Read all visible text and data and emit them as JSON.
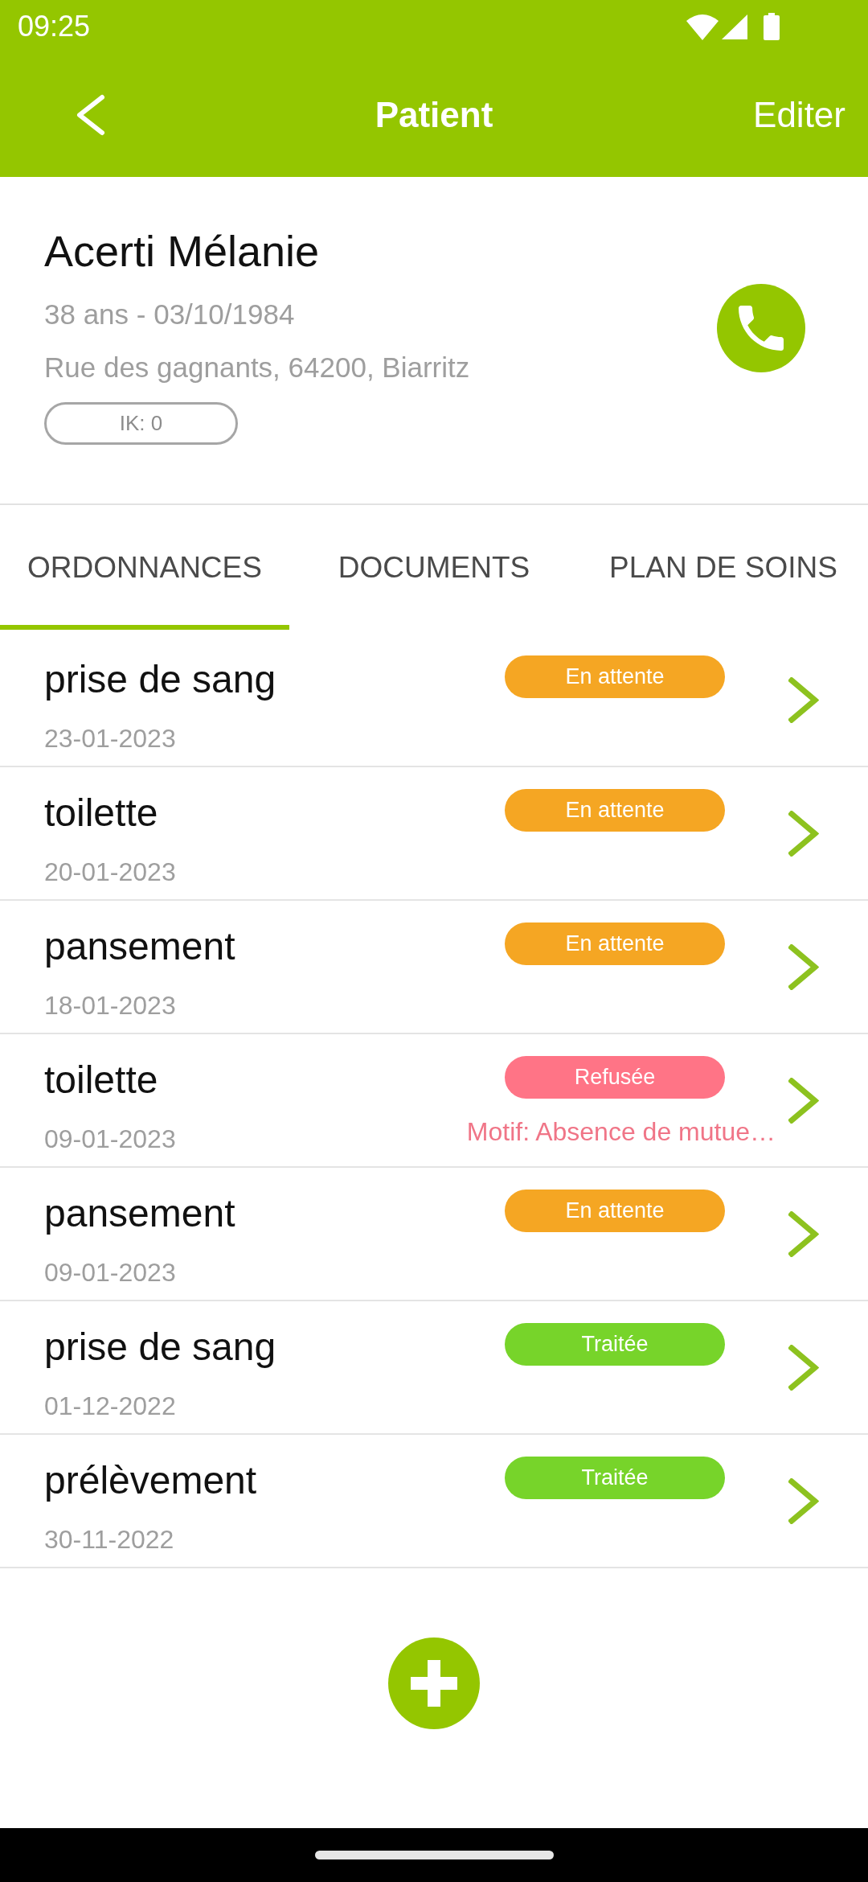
{
  "status_bar": {
    "time": "09:25"
  },
  "toolbar": {
    "title": "Patient",
    "action": "Editer"
  },
  "patient": {
    "name": "Acerti Mélanie",
    "age_birthdate": "38 ans - 03/10/1984",
    "address": "Rue des gagnants, 64200, Biarritz",
    "ik": "IK: 0"
  },
  "tabs": [
    {
      "label": "ORDONNANCES",
      "selected": true
    },
    {
      "label": "DOCUMENTS",
      "selected": false
    },
    {
      "label": "PLAN DE SOINS",
      "selected": false
    }
  ],
  "prescriptions": [
    {
      "title": "prise de sang",
      "date": "23-01-2023",
      "status": {
        "label": "En attente",
        "color": "#f5a623"
      }
    },
    {
      "title": "toilette",
      "date": "20-01-2023",
      "status": {
        "label": "En attente",
        "color": "#f5a623"
      }
    },
    {
      "title": "pansement",
      "date": "18-01-2023",
      "status": {
        "label": "En attente",
        "color": "#f5a623"
      }
    },
    {
      "title": "toilette",
      "date": "09-01-2023",
      "status": {
        "label": "Refusée",
        "color": "#ff7486"
      },
      "reason": "Motif: Absence de mutue…"
    },
    {
      "title": "pansement",
      "date": "09-01-2023",
      "status": {
        "label": "En attente",
        "color": "#f5a623"
      }
    },
    {
      "title": "prise de sang",
      "date": "01-12-2022",
      "status": {
        "label": "Traitée",
        "color": "#77d42a"
      }
    },
    {
      "title": "prélèvement",
      "date": "30-11-2022",
      "status": {
        "label": "Traitée",
        "color": "#77d42a"
      }
    }
  ]
}
